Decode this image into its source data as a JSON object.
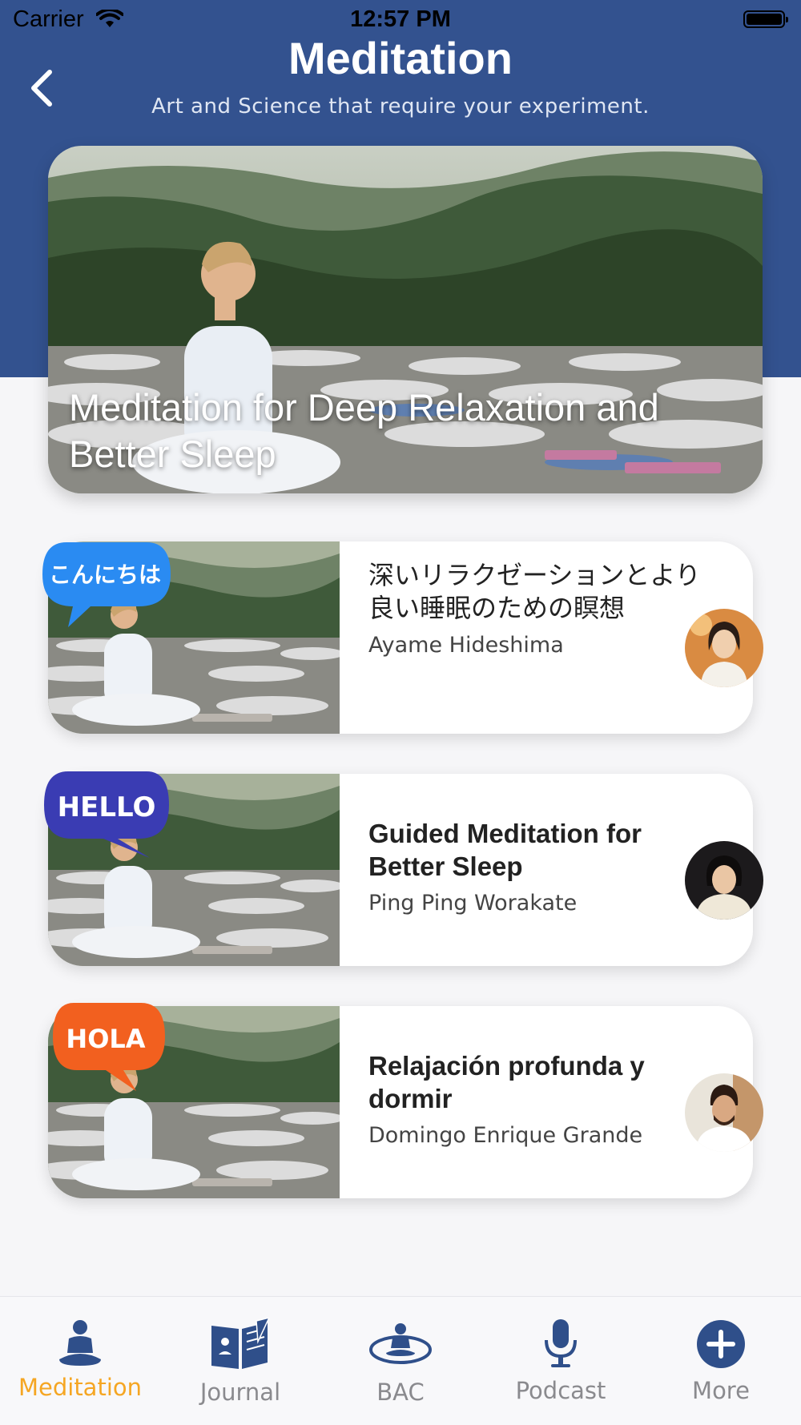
{
  "status_bar": {
    "carrier": "Carrier",
    "time": "12:57 PM"
  },
  "header": {
    "title": "Meditation",
    "subtitle": "Art and Science that require your experiment."
  },
  "hero": {
    "title": "Meditation for Deep Relaxation and Better Sleep"
  },
  "cards": [
    {
      "bubble_text": "こんにちは",
      "bubble_color": "#2a8bf2",
      "title": "深いリラクゼーションとより良い睡眠のための瞑想",
      "author": "Ayame Hideshima"
    },
    {
      "bubble_text": "HELLO",
      "bubble_color": "#3a3cb3",
      "title": "Guided Meditation for Better Sleep",
      "author": "Ping Ping Worakate"
    },
    {
      "bubble_text": "HOLA",
      "bubble_color": "#f2601f",
      "title": "Relajación profunda y dormir",
      "author": "Domingo Enrique Grande"
    }
  ],
  "tabs": [
    {
      "label": "Meditation",
      "icon": "meditation-icon",
      "active": true
    },
    {
      "label": "Journal",
      "icon": "journal-icon",
      "active": false
    },
    {
      "label": "BAC",
      "icon": "bac-icon",
      "active": false
    },
    {
      "label": "Podcast",
      "icon": "podcast-icon",
      "active": false
    },
    {
      "label": "More",
      "icon": "more-icon",
      "active": false
    }
  ],
  "colors": {
    "header_bg": "#33528f",
    "active_tab": "#f5a623",
    "icon_blue": "#2f4f8a"
  }
}
